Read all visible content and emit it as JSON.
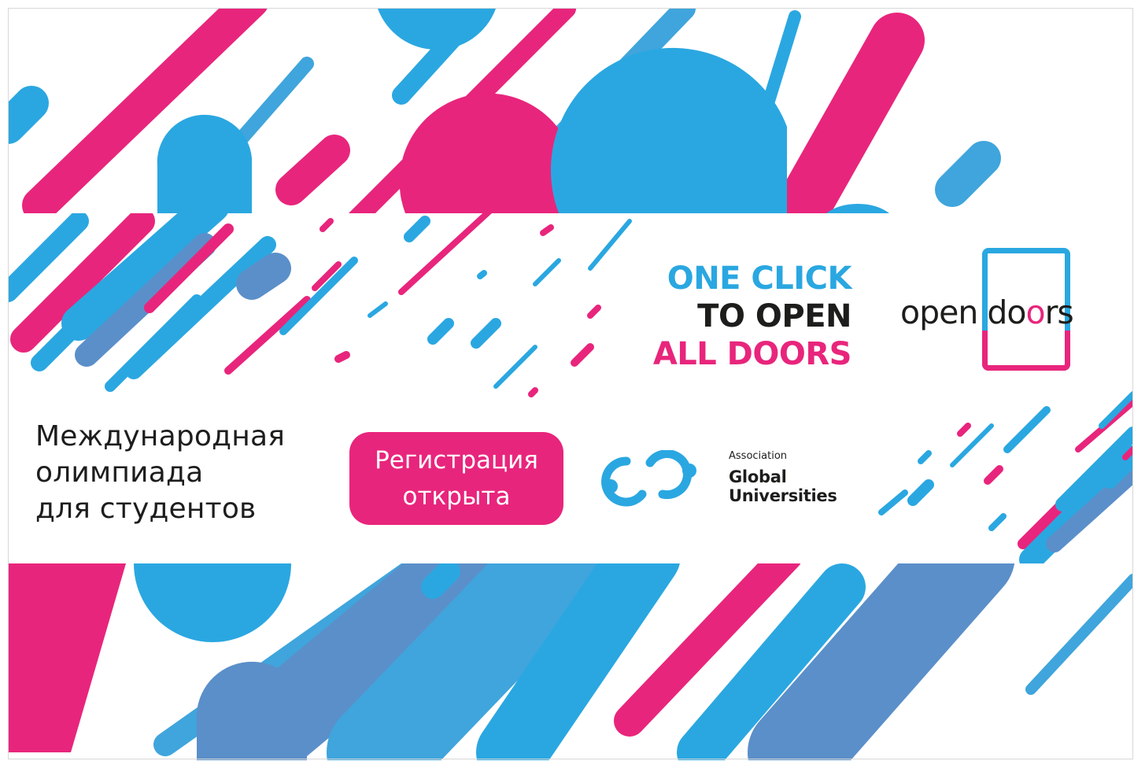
{
  "slogan": {
    "line1": "ONE CLICK",
    "line2": "TO OPEN",
    "line3": "ALL DOORS",
    "colors": {
      "line1": "#2aa7e1",
      "line2": "#1d1d1b",
      "line3": "#e8257c"
    }
  },
  "brand_logo": {
    "text_before": "open do",
    "text_pink": "o",
    "text_after": "rs"
  },
  "headline": {
    "line1": "Международная",
    "line2": "олимпиада",
    "line3": "для студентов"
  },
  "registration_button": {
    "line1": "Регистрация",
    "line2": "открыта"
  },
  "partner_logo": {
    "small_text": "Association",
    "line1": "Global",
    "line2": "Universities",
    "icon": "linked-circles-icon"
  },
  "colors": {
    "pink": "#e8257c",
    "blue": "#2aa7e1",
    "slate_blue": "#5b8fc9",
    "light_blue": "#3fa5dc",
    "text": "#1d1d1b"
  }
}
